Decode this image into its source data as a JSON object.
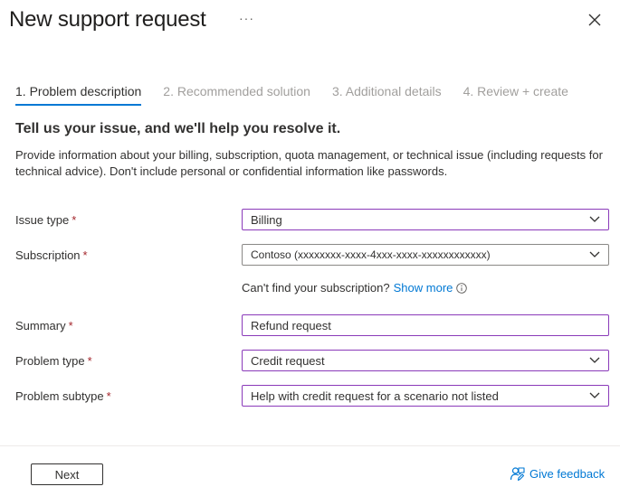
{
  "header": {
    "title": "New support request",
    "more_label": "···"
  },
  "steps": [
    {
      "label": "1. Problem description",
      "active": true
    },
    {
      "label": "2. Recommended solution",
      "active": false
    },
    {
      "label": "3. Additional details",
      "active": false
    },
    {
      "label": "4. Review + create",
      "active": false
    }
  ],
  "content": {
    "heading": "Tell us your issue, and we'll help you resolve it.",
    "description": "Provide information about your billing, subscription, quota management, or technical issue (including requests for technical advice). Don't include personal or confidential information like passwords."
  },
  "form": {
    "required_marker": "*",
    "issue_type": {
      "label": "Issue type",
      "value": "Billing"
    },
    "subscription": {
      "label": "Subscription",
      "value": "Contoso (xxxxxxxx-xxxx-4xxx-xxxx-xxxxxxxxxxxx)"
    },
    "subscription_hint": {
      "text": "Can't find your subscription?",
      "link": "Show more"
    },
    "summary": {
      "label": "Summary",
      "value": "Refund request"
    },
    "problem_type": {
      "label": "Problem type",
      "value": "Credit request"
    },
    "problem_subtype": {
      "label": "Problem subtype",
      "value": "Help with credit request for a scenario not listed"
    }
  },
  "footer": {
    "next_label": "Next",
    "feedback_label": "Give feedback"
  },
  "colors": {
    "accent": "#0078d4",
    "focus_border": "#8a3ab9",
    "required": "#a4262c"
  }
}
